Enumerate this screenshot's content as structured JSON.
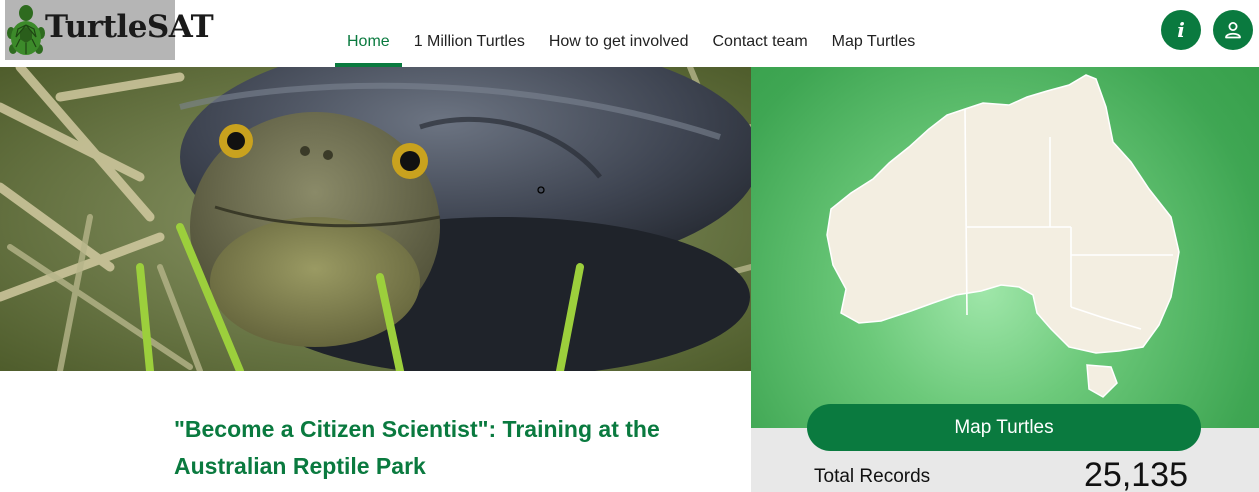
{
  "logo": {
    "text": "TurtleSAT",
    "icon": "turtle-icon"
  },
  "nav": {
    "items": [
      {
        "label": "Home",
        "active": true
      },
      {
        "label": "1 Million Turtles",
        "active": false
      },
      {
        "label": "How to get involved",
        "active": false
      },
      {
        "label": "Contact team",
        "active": false
      },
      {
        "label": "Map Turtles",
        "active": false
      }
    ]
  },
  "header_buttons": {
    "info_label": "i",
    "info_icon": "info-icon",
    "user_icon": "user-icon"
  },
  "hero": {
    "image": "turtle-photo"
  },
  "map_panel": {
    "map_image": "australia-map",
    "button_label": "Map Turtles",
    "stat_label": "Total Records",
    "stat_value": "25,135"
  },
  "article": {
    "title": "\"Become a Citizen Scientist\": Training at the Australian Reptile Park"
  },
  "colors": {
    "brand_green": "#0a7a3f",
    "map_green": "#3fa653",
    "stats_bg": "#e8e8e8"
  }
}
